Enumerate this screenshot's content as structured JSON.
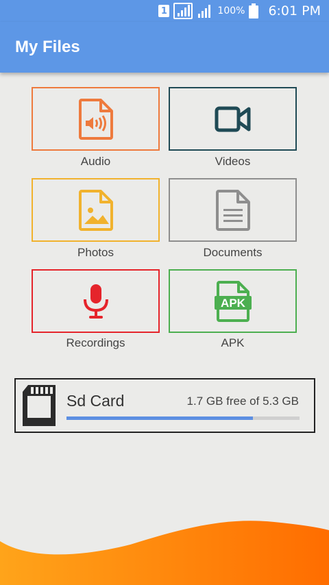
{
  "status_bar": {
    "sim_slot": "1",
    "battery_percent": "100%",
    "time": "6:01 PM"
  },
  "app_bar": {
    "title": "My Files"
  },
  "categories": [
    {
      "label": "Audio",
      "color": "#ee7a3d",
      "icon": "audio-file-icon"
    },
    {
      "label": "Videos",
      "color": "#1f4a55",
      "icon": "video-camera-icon"
    },
    {
      "label": "Photos",
      "color": "#f1b22d",
      "icon": "image-file-icon"
    },
    {
      "label": "Documents",
      "color": "#8e8e8e",
      "icon": "document-icon"
    },
    {
      "label": "Recordings",
      "color": "#e5242b",
      "icon": "microphone-icon"
    },
    {
      "label": "APK",
      "color": "#4caf50",
      "icon": "apk-file-icon",
      "badge_text": "APK"
    }
  ],
  "storage": {
    "name": "Sd Card",
    "free_text": "1.7 GB free of 5.3 GB",
    "used_fraction": 0.8,
    "icon": "sd-card-icon",
    "bar_color": "#5d8fe2"
  },
  "footer": {
    "wave_color": "#ff7a00"
  }
}
